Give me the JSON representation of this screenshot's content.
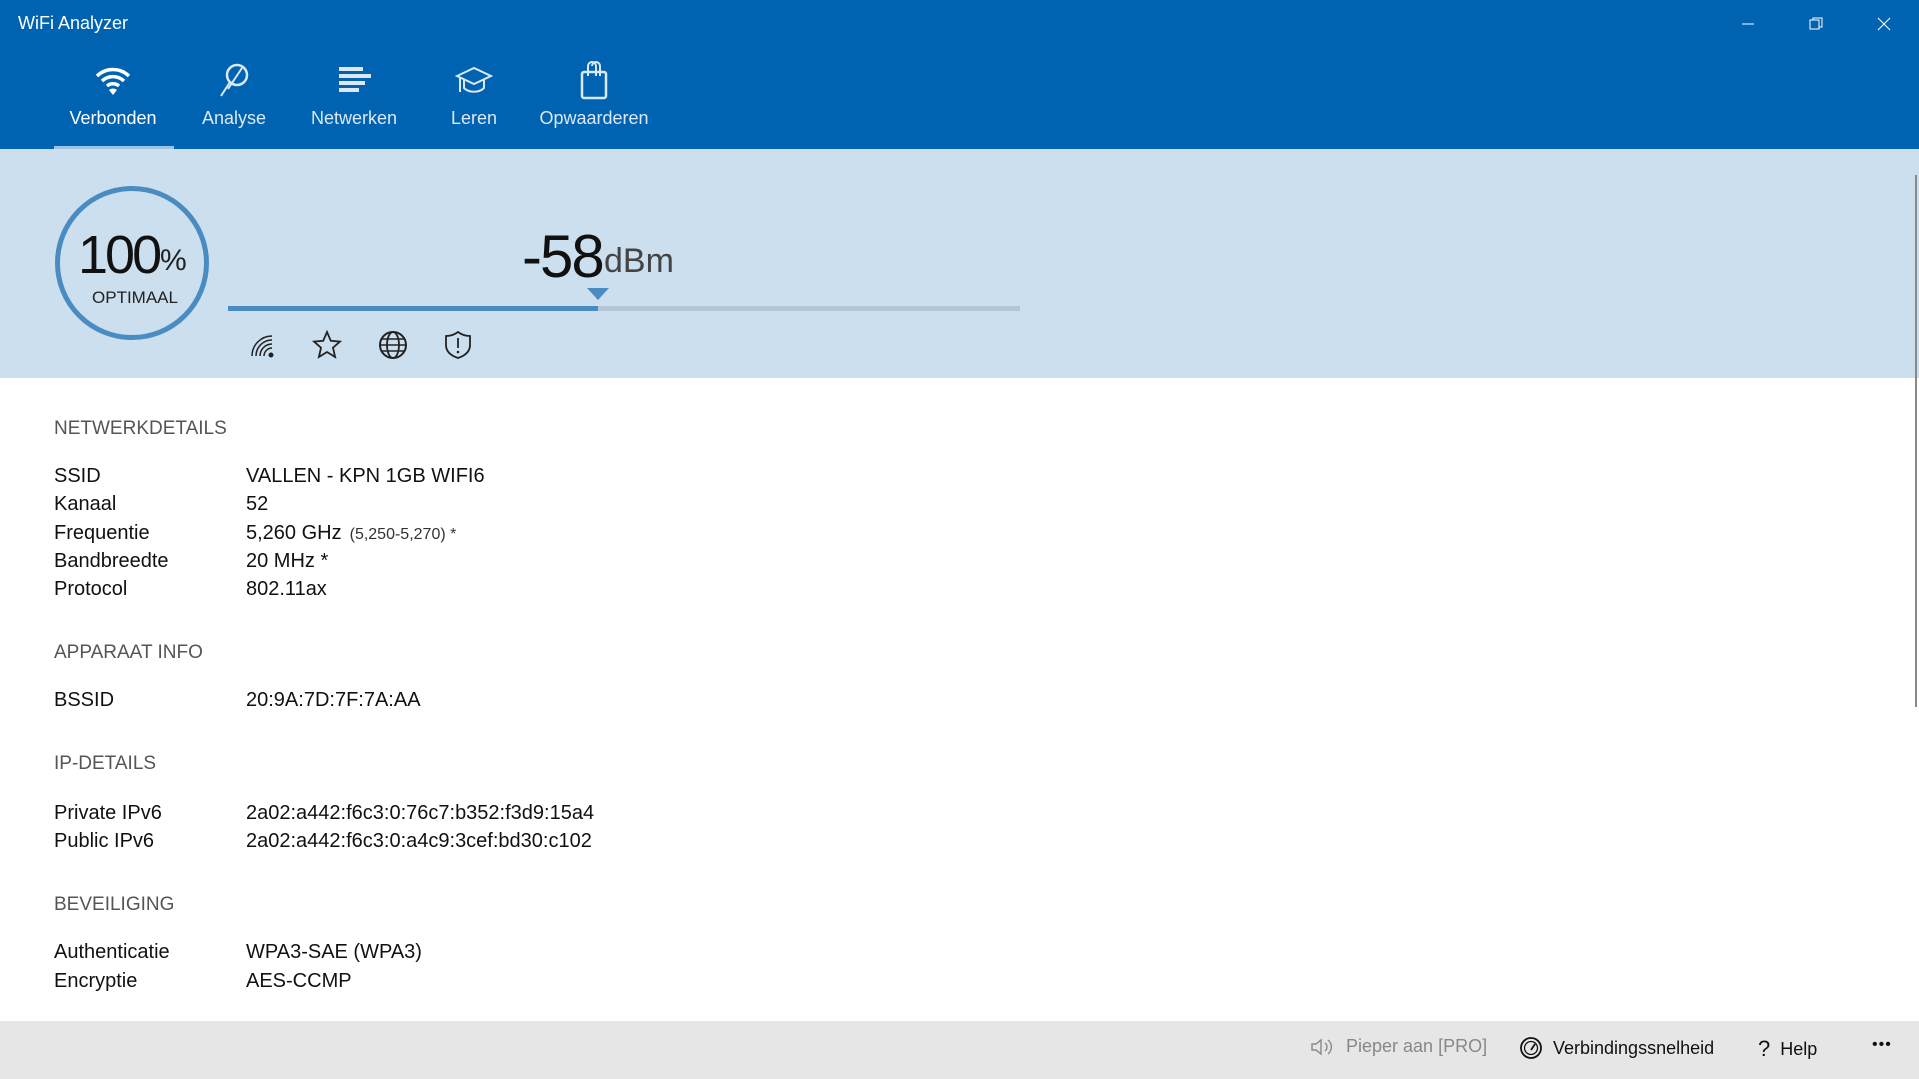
{
  "app": {
    "title": "WiFi Analyzer"
  },
  "tabs": [
    {
      "label": "Verbonden",
      "icon": "wifi-icon"
    },
    {
      "label": "Analyse",
      "icon": "magnifier-icon"
    },
    {
      "label": "Netwerken",
      "icon": "networks-list-icon"
    },
    {
      "label": "Leren",
      "icon": "graduation-cap-icon"
    },
    {
      "label": "Opwaarderen",
      "icon": "shopping-bag-icon"
    }
  ],
  "signal": {
    "percent": "100",
    "percent_sign": "%",
    "quality": "OPTIMAAL",
    "dbm": "-58",
    "unit": "dBm",
    "bar_fill_fraction": 0.467
  },
  "sections": {
    "network": {
      "heading": "NETWERKDETAILS",
      "rows": [
        {
          "label": "SSID",
          "value": "VALLEN - KPN 1GB WIFI6"
        },
        {
          "label": "Kanaal",
          "value": "52"
        },
        {
          "label": "Frequentie",
          "value": "5,260 GHz",
          "extra": "(5,250-5,270) *"
        },
        {
          "label": "Bandbreedte",
          "value": "20 MHz *"
        },
        {
          "label": "Protocol",
          "value": "802.11ax"
        }
      ]
    },
    "device": {
      "heading": "APPARAAT INFO",
      "rows": [
        {
          "label": "BSSID",
          "value": "20:9A:7D:7F:7A:AA"
        }
      ]
    },
    "ip": {
      "heading": "IP-DETAILS",
      "rows": [
        {
          "label": "Private IPv6",
          "value": "2a02:a442:f6c3:0:76c7:b352:f3d9:15a4"
        },
        {
          "label": "Public IPv6",
          "value": "2a02:a442:f6c3:0:a4c9:3cef:bd30:c102"
        }
      ]
    },
    "security": {
      "heading": "BEVEILIGING",
      "rows": [
        {
          "label": "Authenticatie",
          "value": "WPA3-SAE (WPA3)"
        },
        {
          "label": "Encryptie",
          "value": "AES-CCMP"
        }
      ]
    }
  },
  "bottom": {
    "beeper": "Pieper aan [PRO]",
    "speed": "Verbindingssnelheid",
    "help": "Help",
    "more": "•••"
  },
  "colors": {
    "header": "#0063B1",
    "panel": "#CCDFEE",
    "accent": "#4A8BC1"
  }
}
